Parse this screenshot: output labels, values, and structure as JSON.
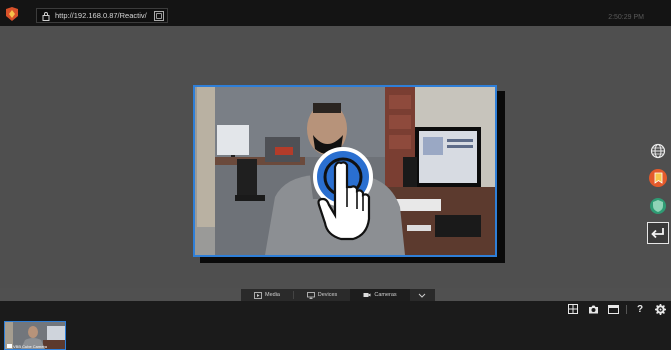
{
  "browser": {
    "url": "http://192.168.0.87/Reactiv/",
    "clock": "2:50:29 PM"
  },
  "tabs": [
    {
      "label": "Media",
      "icon": "media-icon",
      "active": false
    },
    {
      "label": "Devices",
      "icon": "monitor-icon",
      "active": false
    },
    {
      "label": "Cameras",
      "icon": "camera-icon",
      "active": true
    }
  ],
  "thumbnail": {
    "label": "VBB Cube Camera"
  },
  "right_toolbar": [
    "globe-icon",
    "bookmark-icon",
    "shield-icon",
    "return-icon"
  ],
  "bottom_controls": [
    "grid-icon",
    "camera-snapshot-icon",
    "window-icon",
    "help-icon",
    "gear-icon"
  ],
  "colors": {
    "accent": "#2f7fd8",
    "background": "#505050",
    "bar": "#1b1b1b"
  }
}
